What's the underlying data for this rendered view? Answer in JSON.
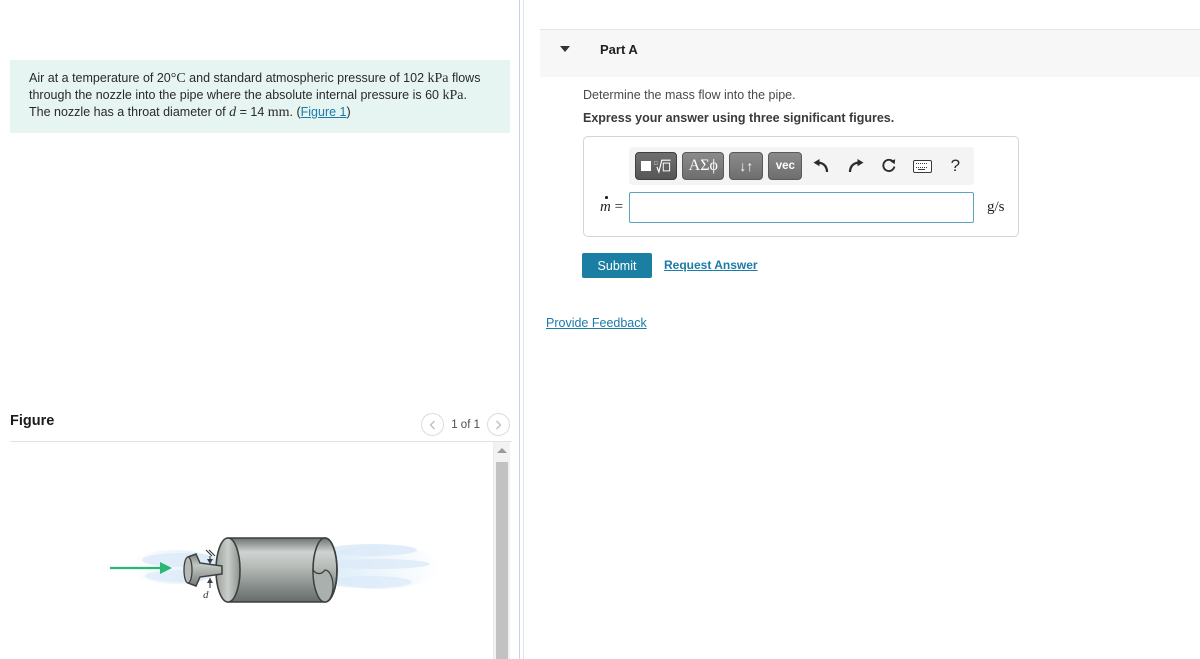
{
  "problem": {
    "text_part1": "Air at a temperature of 20",
    "degC": "°C",
    "text_part2": " and standard atmospheric pressure of 102 ",
    "unit_kpa1": "kPa",
    "text_part3": " flows through the nozzle into the pipe where the absolute internal pressure is 60 ",
    "unit_kpa2": "kPa",
    "text_part4": ". The nozzle has a throat diameter of ",
    "var_d": "d",
    "text_part5": " = 14 ",
    "unit_mm": "mm",
    "text_part6": ". (",
    "figure_link": "Figure 1",
    "text_part7": ")"
  },
  "figure": {
    "title": "Figure",
    "count_label": "1 of 1",
    "prev_icon": "chevron-left-icon",
    "next_icon": "chevron-right-icon",
    "diagram_label_d": "d",
    "scroll_up_icon": "triangle-up-icon"
  },
  "part": {
    "caret_icon": "caret-down-icon",
    "title": "Part A",
    "question": "Determine the mass flow into the pipe.",
    "instruction": "Express your answer using three significant figures."
  },
  "answer": {
    "label_symbol": "m",
    "label_equals": " =",
    "input_value": "",
    "input_placeholder": "",
    "units": "g/s",
    "toolbar": {
      "template_button": {
        "name": "square-root-template-icon",
        "glyph": "√"
      },
      "greek_button": {
        "name": "greek-letters-icon",
        "label": "ΑΣϕ"
      },
      "sort_button": {
        "name": "arrows-updown-icon",
        "label": "↓↑"
      },
      "vec_button": {
        "name": "vector-icon",
        "label": "vec"
      },
      "undo_button": {
        "name": "undo-icon",
        "glyph": "↶"
      },
      "redo_button": {
        "name": "redo-icon",
        "glyph": "↷"
      },
      "reset_button": {
        "name": "reset-icon",
        "glyph": "↻"
      },
      "keyboard_button": {
        "name": "keyboard-icon"
      },
      "help_button": {
        "name": "help-icon",
        "glyph": "?"
      }
    }
  },
  "actions": {
    "submit_label": "Submit",
    "request_answer_label": "Request Answer",
    "provide_feedback_label": "Provide Feedback"
  },
  "colors": {
    "accent_teal": "#1b7fa3",
    "link_blue": "#1c7ba8",
    "problem_bg": "#e6f4f2",
    "panel_bg": "#f7f7f7",
    "arrow_green": "#2bb673",
    "spray_blue": "#cfe5f7"
  }
}
